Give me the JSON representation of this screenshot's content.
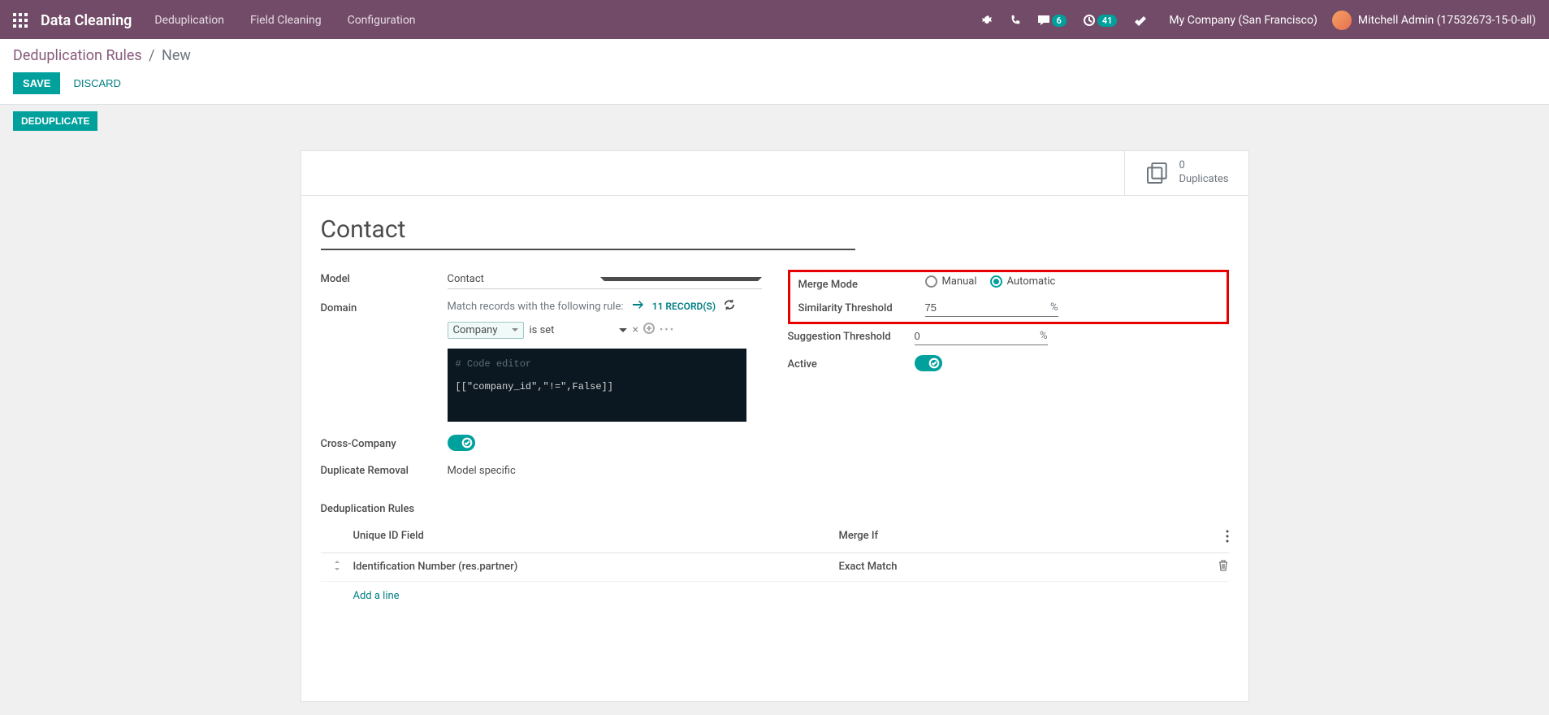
{
  "navbar": {
    "brand": "Data Cleaning",
    "menu": [
      "Deduplication",
      "Field Cleaning",
      "Configuration"
    ],
    "messages_badge": "6",
    "activities_badge": "41",
    "company": "My Company (San Francisco)",
    "user": "Mitchell Admin (17532673-15-0-all)"
  },
  "breadcrumb": {
    "parent": "Deduplication Rules",
    "current": "New"
  },
  "buttons": {
    "save": "SAVE",
    "discard": "DISCARD",
    "deduplicate": "DEDUPLICATE"
  },
  "stat": {
    "count": "0",
    "label": "Duplicates"
  },
  "title": "Contact",
  "left": {
    "model_label": "Model",
    "model_value": "Contact",
    "domain_label": "Domain",
    "domain_text": "Match records with the following rule:",
    "record_count": "11 RECORD(S)",
    "domain_field": "Company",
    "domain_op": "is set",
    "code_comment": "# Code editor",
    "code_body": "[[\"company_id\",\"!=\",False]]",
    "cross_company_label": "Cross-Company",
    "dup_removal_label": "Duplicate Removal",
    "dup_removal_value": "Model specific"
  },
  "right": {
    "merge_mode_label": "Merge Mode",
    "merge_manual": "Manual",
    "merge_auto": "Automatic",
    "sim_threshold_label": "Similarity Threshold",
    "sim_threshold_value": "75",
    "sug_threshold_label": "Suggestion Threshold",
    "sug_threshold_value": "0",
    "percent": "%",
    "active_label": "Active"
  },
  "rules": {
    "section": "Deduplication Rules",
    "col_field": "Unique ID Field",
    "col_merge": "Merge If",
    "row_field": "Identification Number (res.partner)",
    "row_merge": "Exact Match",
    "add_line": "Add a line"
  }
}
